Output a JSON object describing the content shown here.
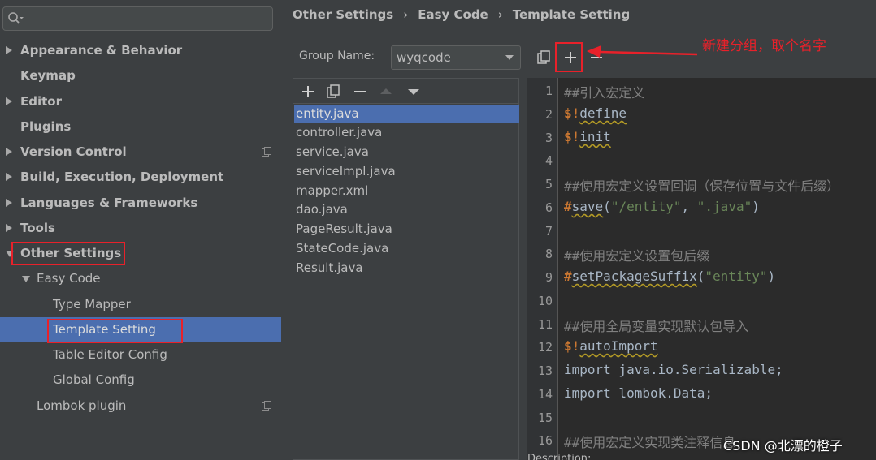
{
  "sidebar": {
    "search_placeholder": "",
    "items": [
      {
        "label": "Appearance & Behavior"
      },
      {
        "label": "Keymap"
      },
      {
        "label": "Editor"
      },
      {
        "label": "Plugins"
      },
      {
        "label": "Version Control"
      },
      {
        "label": "Build, Execution, Deployment"
      },
      {
        "label": "Languages & Frameworks"
      },
      {
        "label": "Tools"
      },
      {
        "label": "Other Settings"
      },
      {
        "label": "Easy Code"
      },
      {
        "label": "Type Mapper"
      },
      {
        "label": "Template Setting"
      },
      {
        "label": "Table Editor Config"
      },
      {
        "label": "Global Config"
      },
      {
        "label": "Lombok plugin"
      }
    ]
  },
  "breadcrumb": [
    "Other Settings",
    "Easy Code",
    "Template Setting"
  ],
  "breadcrumb_sep": "›",
  "group": {
    "label": "Group Name:",
    "value": "wyqcode"
  },
  "files": [
    "entity.java",
    "controller.java",
    "service.java",
    "serviceImpl.java",
    "mapper.xml",
    "dao.java",
    "PageResult.java",
    "StateCode.java",
    "Result.java"
  ],
  "editor": {
    "line_numbers": [
      "1",
      "2",
      "3",
      "4",
      "5",
      "6",
      "7",
      "8",
      "9",
      "10",
      "11",
      "12",
      "13",
      "14",
      "15",
      "16"
    ],
    "lines": {
      "l1": "##引入宏定义",
      "l2_prefix": "$!",
      "l2_name": "define",
      "l3_prefix": "$!",
      "l3_name": "init",
      "l5": "##使用宏定义设置回调（保存位置与文件后缀）",
      "l6_prefix": "#",
      "l6_name": "save",
      "l6_open": "(",
      "l6_arg1": "\"/entity\"",
      "l6_comma": ", ",
      "l6_arg2": "\".java\"",
      "l6_close": ")",
      "l8": "##使用宏定义设置包后缀",
      "l9_prefix": "#",
      "l9_name": "setPackageSuffix",
      "l9_open": "(",
      "l9_arg1": "\"entity\"",
      "l9_close": ")",
      "l11": "##使用全局变量实现默认包导入",
      "l12_prefix": "$!",
      "l12_name": "autoImport",
      "l13": "import java.io.Serializable;",
      "l14": "import lombok.Data;",
      "l16": "##使用宏定义实现类注释信息"
    }
  },
  "description_label": "Description:",
  "annotation": "新建分组，取个名字",
  "watermark": "CSDN @北漂的橙子",
  "colors": {
    "accent_selection": "#4b6eaf",
    "highlight_box": "#e8212a",
    "background": "#3c3f41",
    "editor_bg": "#2b2b2b"
  }
}
